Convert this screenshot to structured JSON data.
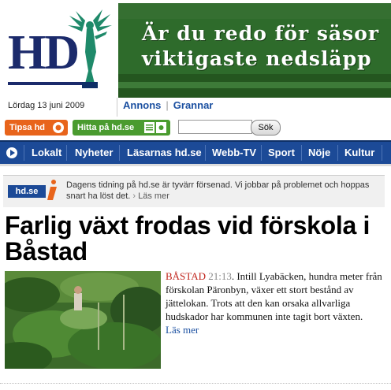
{
  "header": {
    "logo_text": "HD",
    "date": "Lördag 13 juni 2009",
    "top_links": [
      "Annons",
      "Grannar"
    ],
    "banner": {
      "line1": "Är du redo för säsor",
      "line2": "viktigaste nedsläpp"
    }
  },
  "toolbar": {
    "tips_label": "Tipsa hd",
    "hitta_label": "Hitta på hd.se",
    "search_placeholder": "",
    "search_button": "Sök"
  },
  "nav": {
    "items": [
      "Lokalt",
      "Nyheter",
      "Läsarnas hd.se",
      "Webb-TV",
      "Sport",
      "Nöje",
      "Kultur"
    ]
  },
  "notice": {
    "logo": "hd.se",
    "text": "Dagens tidning på hd.se är tyvärr försenad. Vi jobbar på problemet och hoppas snart ha löst det.",
    "more": "Läs mer"
  },
  "article": {
    "headline": "Farlig växt frodas vid förskola i Båstad",
    "location": "BÅSTAD",
    "time": "21:13",
    "body": "Intill Lyabäcken, hundra meter från förskolan Päronbyn, växer ett stort bestånd av jättelokan. Trots att den kan orsaka allvarliga hudskador har kommunen inte tagit bort växten.",
    "more": "Läs mer"
  },
  "colors": {
    "brand_blue": "#1c4a97",
    "tips_orange": "#e8641b",
    "hitta_green": "#4a9b2f",
    "location_red": "#c0231b"
  }
}
